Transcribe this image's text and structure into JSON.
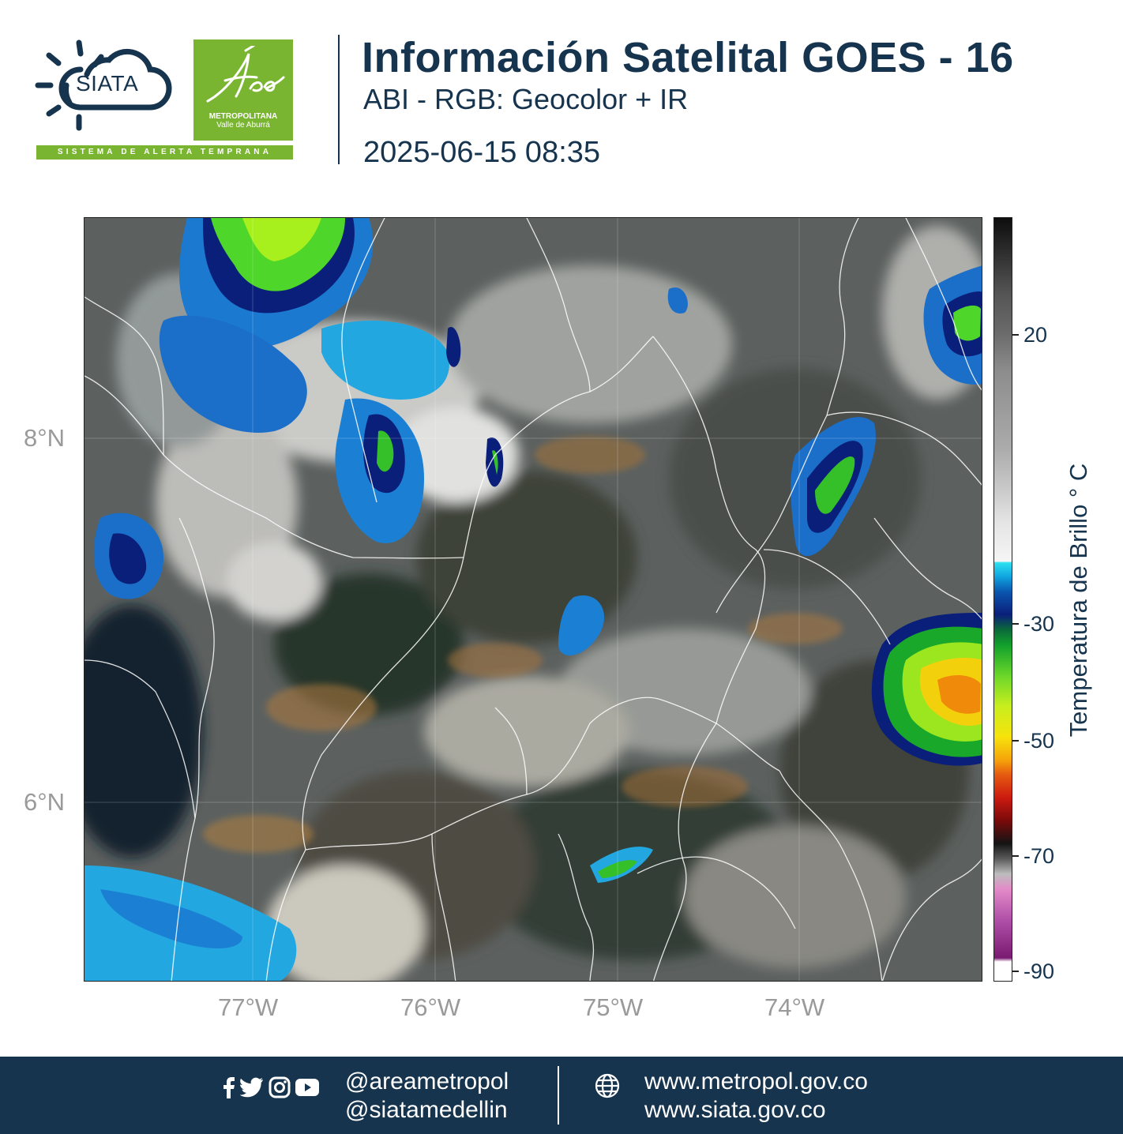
{
  "header": {
    "siata_logo_text": "SIATA",
    "area_logo_script": "Área",
    "area_logo_line1": "METROPOLITANA",
    "area_logo_line2": "Valle de Aburrá",
    "logo_strip_text": "SISTEMA DE ALERTA TEMPRANA",
    "title": "Información Satelital GOES - 16",
    "subtitle": "ABI - RGB: Geocolor + IR",
    "datetime": "2025-06-15 08:35"
  },
  "map": {
    "lat_labels": [
      "8°N",
      "6°N"
    ],
    "lon_labels": [
      "77°W",
      "76°W",
      "75°W",
      "74°W"
    ]
  },
  "colorbar": {
    "title": "Temperatura de Brillo ° C",
    "tick_labels": [
      "20",
      "-30",
      "-50",
      "-70",
      "-90"
    ],
    "colors": {
      "warm_top": "#0d0d0d",
      "cold_start": "#2ce0f0",
      "deep_blue": "#0a1f7a",
      "green": "#12a02c",
      "yellow": "#f7e30c",
      "red": "#cc1a10",
      "magenta": "#b050a8"
    }
  },
  "footer": {
    "handle_1": "@areametropol",
    "handle_2": "@siatamedellin",
    "url_1": "www.metropol.gov.co",
    "url_2": "www.siata.gov.co",
    "social_icons": [
      "facebook-icon",
      "twitter-icon",
      "instagram-icon",
      "youtube-icon"
    ],
    "globe_icon": "globe-icon",
    "colors": {
      "background": "#16344e",
      "text": "#ffffff"
    }
  }
}
